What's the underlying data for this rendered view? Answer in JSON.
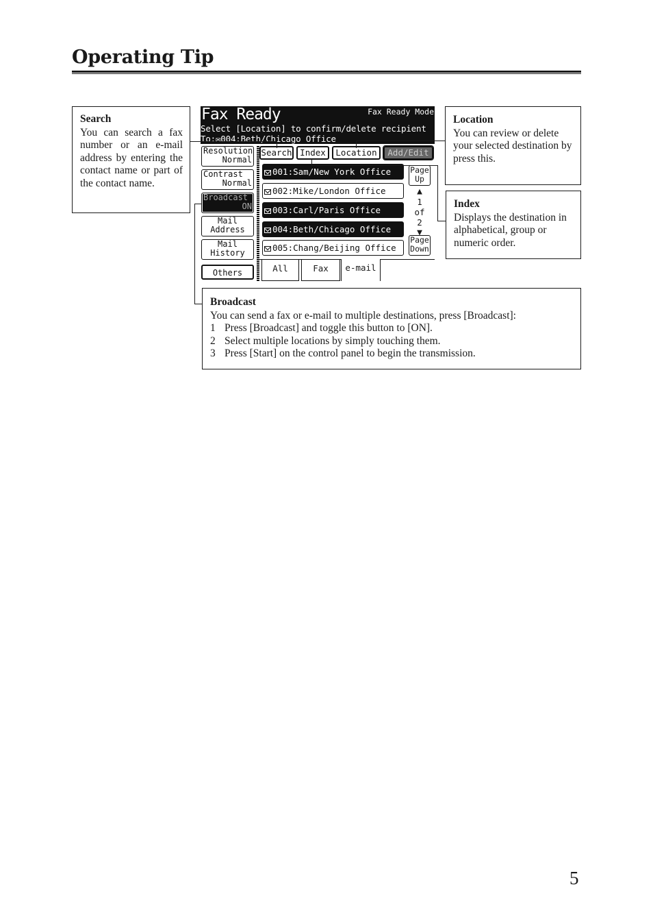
{
  "heading": "Operating Tip",
  "page_number": "5",
  "callouts": {
    "search": {
      "title": "Search",
      "body": "You can search a fax number or an e-mail address by entering the contact name or part of the contact name."
    },
    "location": {
      "title": "Location",
      "body": "You can review or delete your selected destination by press this."
    },
    "index": {
      "title": "Index",
      "body": "Displays the destination in alphabetical, group or numeric order."
    },
    "broadcast": {
      "title": "Broadcast",
      "intro": "You can send a fax or e-mail to multiple destinations, press [Broadcast]:",
      "steps": [
        {
          "num": "1",
          "text": "Press [Broadcast] and toggle this button to [ON]."
        },
        {
          "num": "2",
          "text": "Select multiple locations by simply touching them."
        },
        {
          "num": "3",
          "text": "Press [Start] on the control panel to begin the transmission."
        }
      ]
    }
  },
  "lcd": {
    "title": "Fax Ready",
    "mode": "Fax Ready Mode",
    "instruction": "Select [Location] to confirm/delete recipient",
    "to_line": "To:✉004:Beth/Chicago Office",
    "left_buttons": [
      {
        "line1": "Resolution",
        "line2": "Normal"
      },
      {
        "line1": "Contrast",
        "line2": "Normal"
      },
      {
        "line1": "Broadcast",
        "line2": "ON"
      },
      {
        "line1": "Mail",
        "line2": "Address"
      },
      {
        "line1": "Mail",
        "line2": "History"
      },
      {
        "line1": "Others"
      }
    ],
    "top_buttons": [
      "Search",
      "Index",
      "Location",
      "Add/Edit"
    ],
    "entries": [
      {
        "label": "001:Sam/New York Office",
        "selected": true
      },
      {
        "label": "002:Mike/London Office",
        "selected": false
      },
      {
        "label": "003:Carl/Paris Office",
        "selected": true
      },
      {
        "label": "004:Beth/Chicago Office",
        "selected": true
      },
      {
        "label": "005:Chang/Beijing Office",
        "selected": false
      }
    ],
    "page_up": {
      "line1": "Page",
      "line2": "Up"
    },
    "page_down": {
      "line1": "Page",
      "line2": "Down"
    },
    "page_info": {
      "current": "1",
      "of": "of",
      "total": "2"
    },
    "tabs": [
      "All",
      "Fax",
      "e-mail"
    ]
  }
}
